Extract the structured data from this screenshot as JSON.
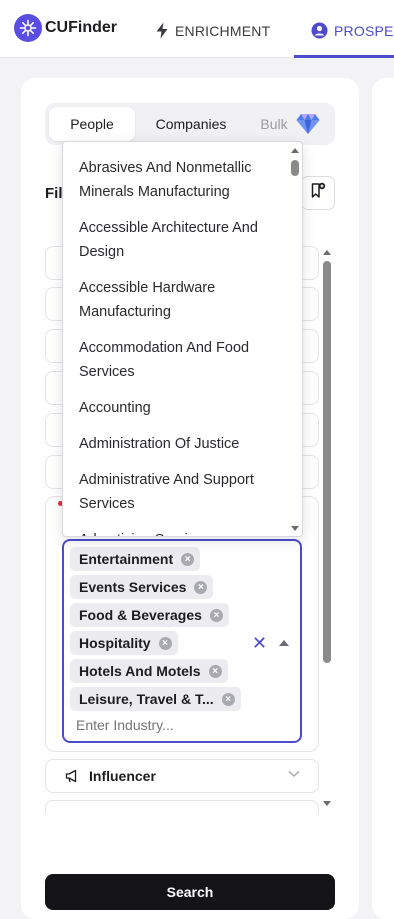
{
  "app": {
    "name": "CUFinder"
  },
  "nav": {
    "enrichment_label": "ENRICHMENT",
    "prospect_label": "PROSPEC",
    "accent": "#4c4ccc"
  },
  "tabs": {
    "people": "People",
    "companies": "Companies",
    "bulk": "Bulk"
  },
  "filters": {
    "title": "Fil"
  },
  "industry": {
    "options": [
      "Abrasives And Nonmetallic Minerals Manufacturing",
      "Accessible Architecture And Design",
      "Accessible Hardware Manufacturing",
      "Accommodation And Food Services",
      "Accounting",
      "Administration Of Justice",
      "Administrative And Support Services",
      "Advertising Services"
    ],
    "selected": [
      "Entertainment",
      "Events Services",
      "Food & Beverages",
      "Hospitality",
      "Hotels And Motels",
      "Leisure, Travel & T..."
    ],
    "placeholder": "Enter Industry..."
  },
  "influencer": {
    "label": "Influencer"
  },
  "search": {
    "label": "Search"
  },
  "icons": {
    "logo": "cufinder-logo-icon",
    "enrichment": "lightning-icon",
    "prospect": "user-circle-icon",
    "bulk": "diamond-icon",
    "save": "bookmark-add-icon",
    "influencer": "megaphone-icon",
    "chevron": "chevron-down-icon",
    "remove": "remove-chip-icon",
    "clear": "clear-x-icon"
  }
}
